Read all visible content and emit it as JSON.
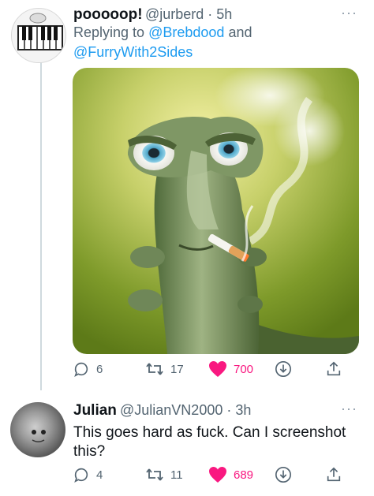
{
  "tweets": [
    {
      "display_name": "pooooop!",
      "handle_time": "@jurberd · 5h",
      "replying_prefix": "Replying to",
      "replying_mention_1": "@Brebdood",
      "replying_and": "and",
      "replying_mention_2": "@FurryWith2Sides",
      "more": "···",
      "media_subject": "cartoon caterpillar smoking a cigarette",
      "replies": "6",
      "retweets": "17",
      "likes": "700"
    },
    {
      "display_name": "Julian",
      "handle_time": "@JulianVN2000 · 3h",
      "text": "This goes hard as fuck. Can I screenshot this?",
      "more": "···",
      "replies": "4",
      "retweets": "11",
      "likes": "689"
    }
  ],
  "colors": {
    "like_active": "#f91880",
    "mention": "#1d9bf0",
    "secondary_text": "#536471",
    "thread_line": "#cfd9de"
  }
}
